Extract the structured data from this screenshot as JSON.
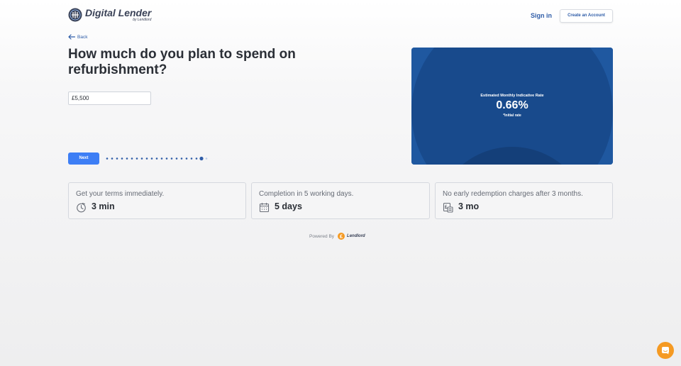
{
  "header": {
    "logo_title": "Digital Lender",
    "logo_subtitle": "by Lendlord",
    "signin_label": "Sign in",
    "create_account_label": "Create an Account"
  },
  "nav": {
    "back_label": "Back"
  },
  "form": {
    "question": "How much do you plan to spend on refurbishment?",
    "amount_value": "£5,500",
    "next_label": "Next",
    "progress": {
      "total_steps": 21,
      "current_step": 20
    }
  },
  "rate": {
    "label": "Estimated Monthly Indicative Rate",
    "value": "0.66%",
    "note": "*Initial rate"
  },
  "features": [
    {
      "title": "Get your terms immediately.",
      "value": "3 min",
      "icon": "timer-icon"
    },
    {
      "title": "Completion in 5 working days.",
      "value": "5 days",
      "icon": "calendar-icon"
    },
    {
      "title": "No early redemption charges after 3 months.",
      "value": "3 mo",
      "icon": "pound-document-icon"
    }
  ],
  "footer": {
    "powered_label": "Powered By",
    "brand": "Lendlord"
  },
  "colors": {
    "accent": "#3d7ef5",
    "link": "#2f5da8",
    "rate_card": "#1f58a0",
    "chat_button": "#f59a23"
  }
}
